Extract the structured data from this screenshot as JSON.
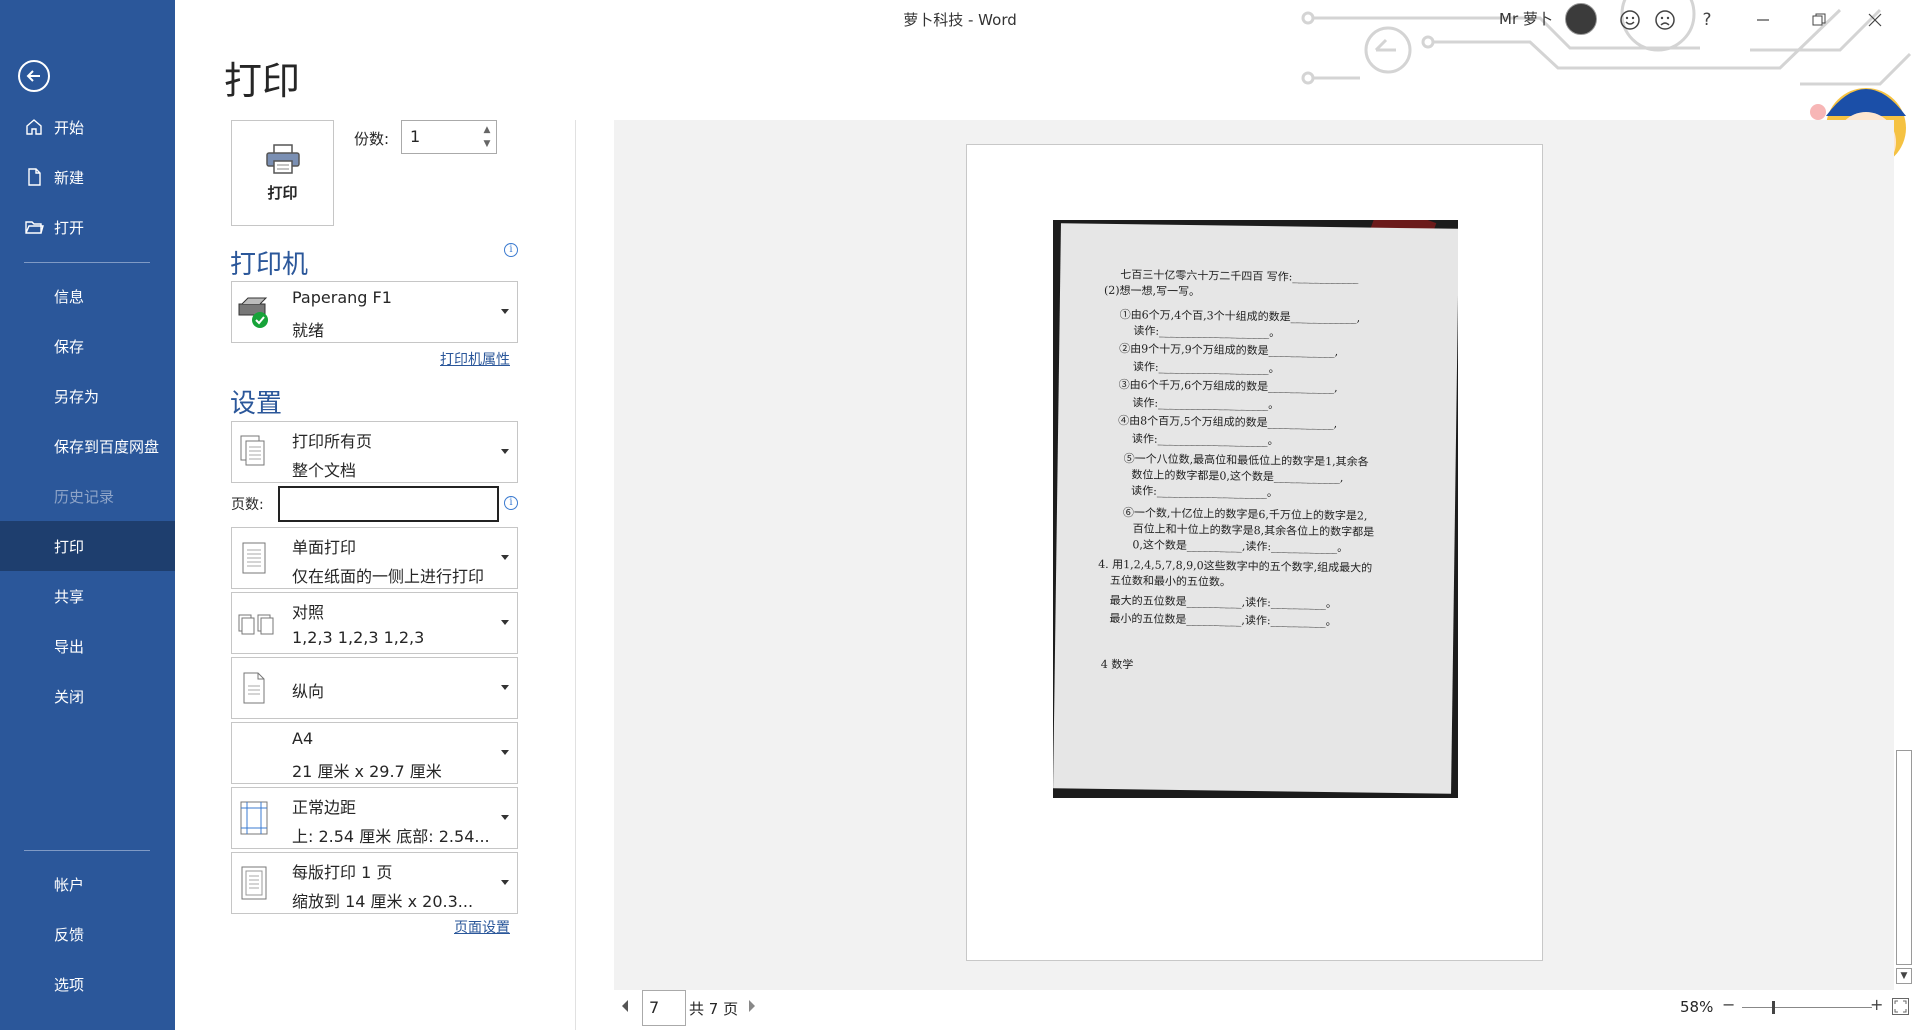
{
  "window": {
    "title": "萝卜科技  -  Word",
    "user_name": "Mr 萝卜",
    "help_label": "?"
  },
  "nav": {
    "items": [
      {
        "label": "开始",
        "icon": "home-icon"
      },
      {
        "label": "新建",
        "icon": "new-document-icon"
      },
      {
        "label": "打开",
        "icon": "open-folder-icon"
      },
      {
        "label": "信息"
      },
      {
        "label": "保存"
      },
      {
        "label": "另存为"
      },
      {
        "label": "保存到百度网盘"
      },
      {
        "label": "历史记录"
      },
      {
        "label": "打印"
      },
      {
        "label": "共享"
      },
      {
        "label": "导出"
      },
      {
        "label": "关闭"
      },
      {
        "label": "帐户"
      },
      {
        "label": "反馈"
      },
      {
        "label": "选项"
      }
    ],
    "active": "打印",
    "disabled": "历史记录"
  },
  "print": {
    "heading": "打印",
    "button_label": "打印",
    "copies_label": "份数:",
    "copies_value": "1"
  },
  "printer": {
    "heading": "打印机",
    "name": "Paperang F1",
    "status": "就绪",
    "properties_link": "打印机属性"
  },
  "settings": {
    "heading": "设置",
    "pages_label": "页数:",
    "pages_value": "",
    "range": {
      "line1": "打印所有页",
      "line2": "整个文档"
    },
    "sides": {
      "line1": "单面打印",
      "line2": "仅在纸面的一侧上进行打印"
    },
    "collate": {
      "line1": "对照",
      "line2": "1,2,3    1,2,3    1,2,3"
    },
    "orientation": {
      "line1": "纵向"
    },
    "paper": {
      "line1": "A4",
      "line2": "21 厘米 x 29.7 厘米"
    },
    "margins": {
      "line1": "正常边距",
      "line2": "上: 2.54 厘米 底部: 2.54..."
    },
    "per_sheet": {
      "line1": "每版打印 1 页",
      "line2": "缩放到 14 厘米 x 20.3..."
    },
    "page_setup_link": "页面设置"
  },
  "pager": {
    "current": "7",
    "total_text": "共 7 页"
  },
  "zoom": {
    "percent_text": "58%",
    "minus": "−",
    "plus": "+",
    "level": 0.58
  },
  "preview_text": {
    "lines": [
      "七百三十亿零六十万二千四百    写作:____________",
      "(2)想一想,写一写。",
      "①由6个万,4个百,3个十组成的数是____________,",
      "读作:____________________。",
      "②由9个十万,9个万组成的数是____________,",
      "读作:____________________。",
      "③由6个千万,6个万组成的数是____________,",
      "读作:____________________。",
      "④由8个百万,5个万组成的数是____________,",
      "读作:____________________。",
      "⑤一个八位数,最高位和最低位上的数字是1,其余各",
      "数位上的数字都是0,这个数是____________,",
      "读作:____________________。",
      "⑥一个数,十亿位上的数字是6,千万位上的数字是2,",
      "百位上和十位上的数字是8,其余各位上的数字都是",
      "0,这个数是__________,读作:____________。",
      "4. 用1,2,4,5,7,8,9,0这些数字中的五个数字,组成最大的",
      "五位数和最小的五位数。",
      "最大的五位数是__________,读作:__________。",
      "最小的五位数是__________,读作:__________。",
      "4  数学"
    ]
  },
  "colors": {
    "nav_bg": "#2b579a",
    "nav_active": "#1e3e6e",
    "accent": "#2b579a"
  }
}
